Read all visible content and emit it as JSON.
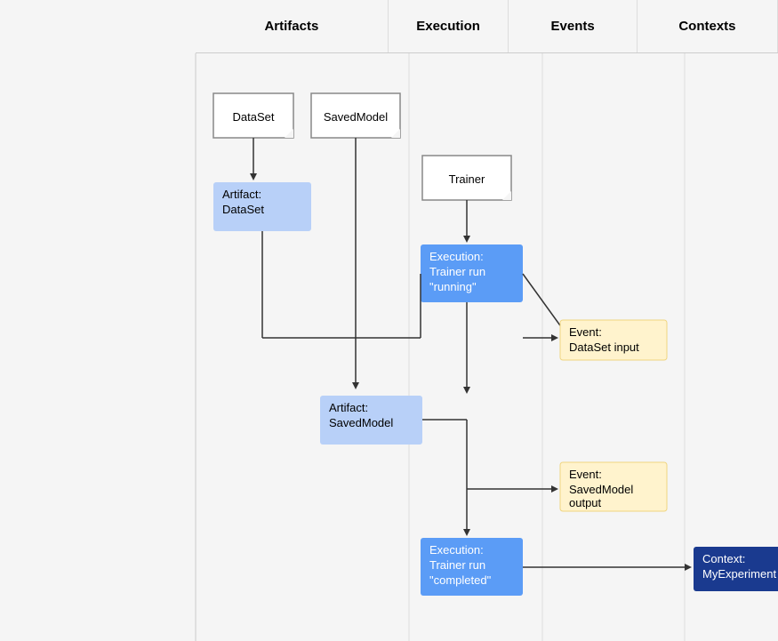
{
  "header": {
    "artifacts_label": "Artifacts",
    "execution_label": "Execution",
    "events_label": "Events",
    "contexts_label": "Contexts"
  },
  "cards": {
    "dataset_type": "DataSet",
    "savedmodel_type": "SavedModel",
    "trainer_type": "Trainer",
    "artifact_dataset": "Artifact:\nDataSet",
    "artifact_savedmodel": "Artifact:\nSavedModel",
    "execution_running": "Execution:\nTrainer run\n\"running\"",
    "execution_completed": "Execution:\nTrainer run\n\"completed\"",
    "event_dataset_input": "Event:\nDataSet input",
    "event_savedmodel_output": "Event:\nSavedModel\noutput",
    "context_myexperiment": "Context:\nMyExperiment"
  }
}
